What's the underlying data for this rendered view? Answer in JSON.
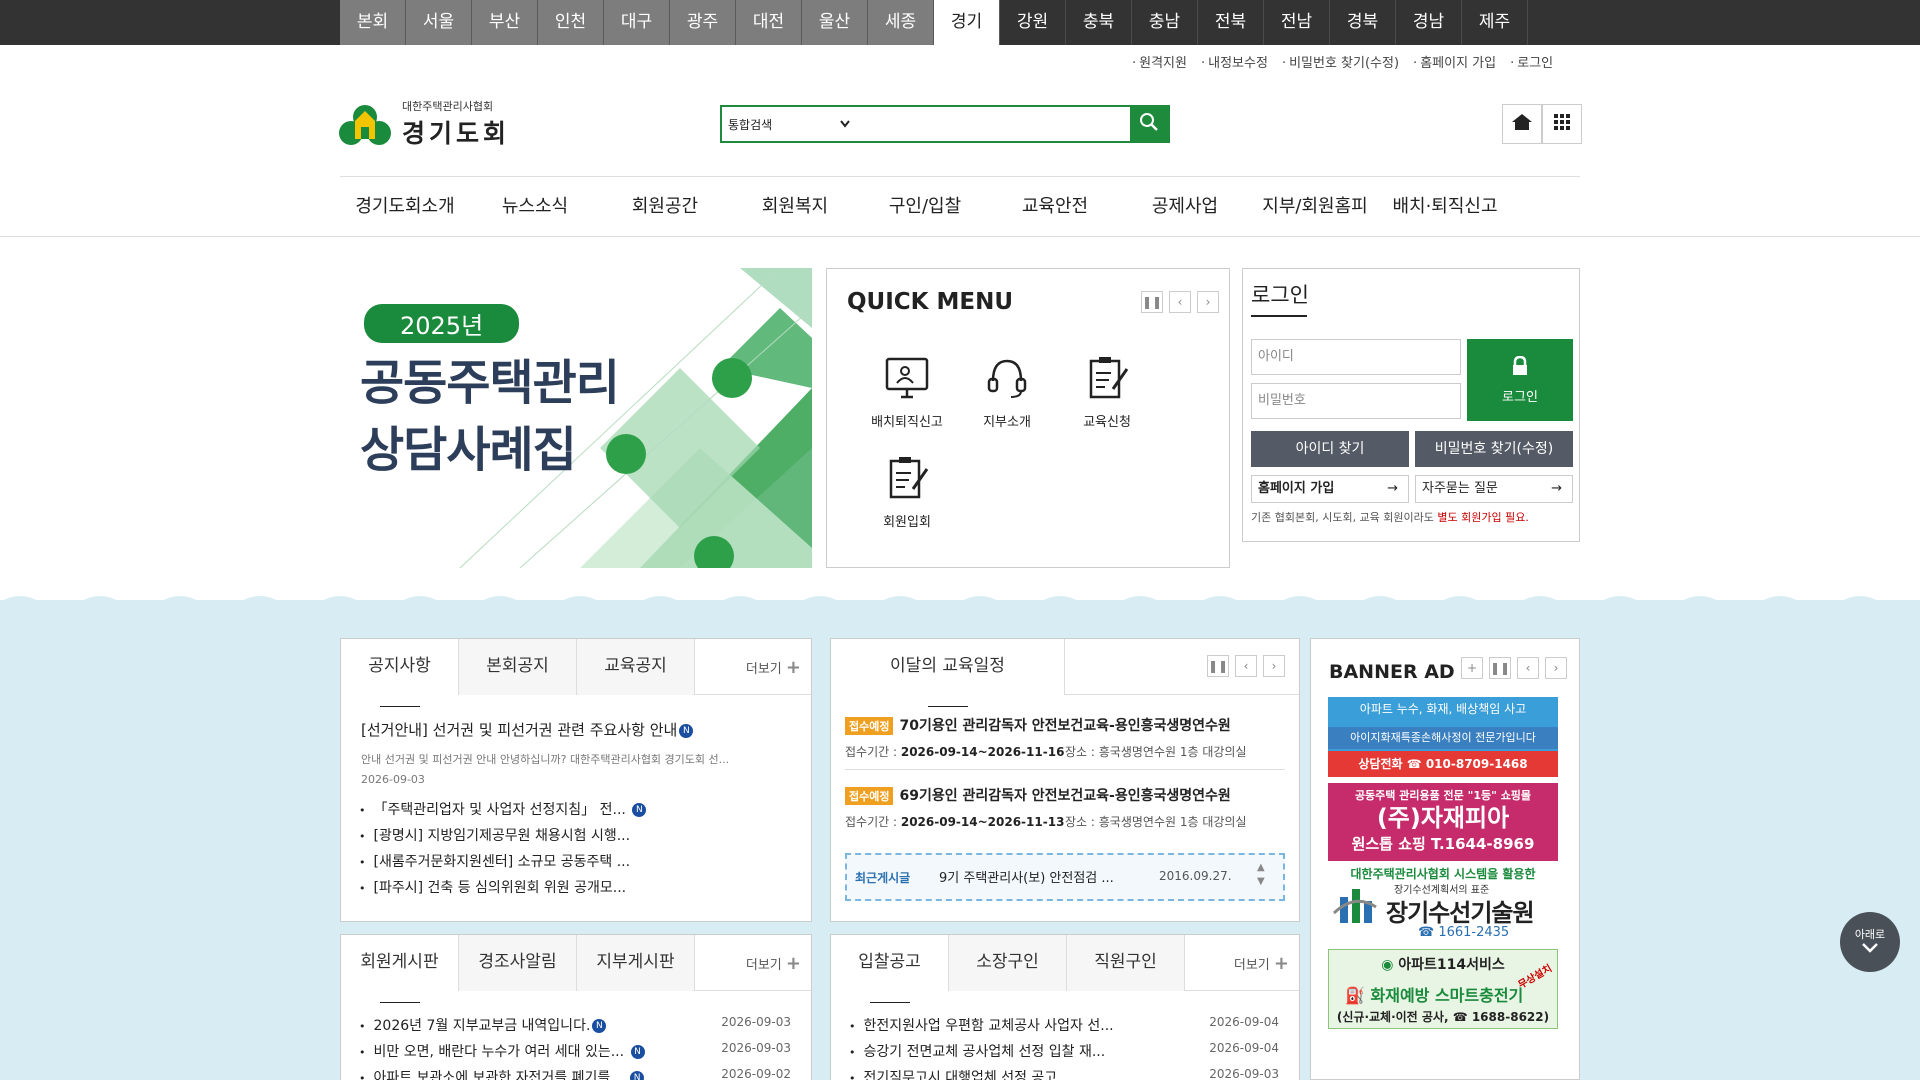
{
  "regions": {
    "tabs": [
      "본회",
      "서울",
      "부산",
      "인천",
      "대구",
      "광주",
      "대전",
      "울산",
      "세종",
      "경기",
      "강원",
      "충북",
      "충남",
      "전북",
      "전남",
      "경북",
      "경남",
      "제주"
    ],
    "active": "경기"
  },
  "util_links": [
    "원격지원",
    "내정보수정",
    "비밀번호 찾기(수정)",
    "홈페이지 가입",
    "로그인"
  ],
  "logo": {
    "small": "대한주택관리사협회",
    "big": "경기도회"
  },
  "search": {
    "select": "통합검색",
    "placeholder": ""
  },
  "gnb": [
    "경기도회소개",
    "뉴스소식",
    "회원공간",
    "회원복지",
    "구인/입찰",
    "교육안전",
    "공제사업",
    "지부/회원홈피",
    "배치·퇴직신고"
  ],
  "visual": {
    "year": "2025년",
    "title_line1": "공동주택관리",
    "title_line2": "상담사례집"
  },
  "quick_menu": {
    "title": "QUICK MENU",
    "items": [
      {
        "label": "배치퇴직신고",
        "icon": "monitor-icon"
      },
      {
        "label": "지부소개",
        "icon": "headset-icon"
      },
      {
        "label": "교육신청",
        "icon": "clipboard-pen-icon"
      },
      {
        "label": "회원입회",
        "icon": "clipboard-pen-icon"
      }
    ]
  },
  "login": {
    "title": "로그인",
    "id_placeholder": "아이디",
    "pw_placeholder": "비밀번호",
    "button": "로그인",
    "find_id": "아이디 찾기",
    "find_pw": "비밀번호 찾기(수정)",
    "join": "홈페이지 가입",
    "faq": "자주묻는 질문",
    "note_prefix": "기존 협회본회, 시도회, 교육 회원이라도 ",
    "note_highlight": "별도 회원가입 필요."
  },
  "notice_box": {
    "tabs": [
      "공지사항",
      "본회공지",
      "교육공지"
    ],
    "more": "더보기",
    "featured_title": "[선거안내] 선거권 및 피선거권 관련 주요사항 안내",
    "featured_summary": "안내 선거권 및 피선거권 안내 안녕하십니까? 대한주택관리사협회 경기도회 선...",
    "featured_date": "2026-09-03",
    "items": [
      "「주택관리업자 및 사업자 선정지침」 전...",
      "[광명시] 지방임기제공무원 채용시험 시행...",
      "[새롬주거문화지원센터] 소규모 공동주택 ...",
      "[파주시] 건축 등 심의위원회 위원 공개모..."
    ]
  },
  "edu_box": {
    "title": "이달의 교육일정",
    "items": [
      {
        "badge": "접수예정",
        "title": "70기용인 관리감독자 안전보건교육-용인흥국생명연수원",
        "period_label": "접수기간 : ",
        "period": "2026-09-14~2026-11-16",
        "place": "장소 : 흥국생명연수원 1층 대강의실"
      },
      {
        "badge": "접수예정",
        "title": "69기용인 관리감독자 안전보건교육-용인흥국생명연수원",
        "period_label": "접수기간 : ",
        "period": "2026-09-14~2026-11-13",
        "place": "장소 : 흥국생명연수원 1층 대강의실"
      }
    ],
    "recent_label": "최근게시글",
    "recent_text": "9기 주택관리사(보) 안전점검 ...",
    "recent_date": "2016.09.27."
  },
  "banner_ad": {
    "title": "BANNER AD",
    "b1_top": "아파트 누수, 화재, 배상책임 사고",
    "b1_mid": "아이지화재특종손해사정이 전문가입니다",
    "b1_bottom": "상담전화 ☎ 010-8709-1468",
    "b2_top": "공동주택 관리용품 전문 \"1등\" 쇼핑몰",
    "b2_mid": "(주)자재피아",
    "b2_bottom": "원스톱 쇼핑 T.1644-8969",
    "b3_top": "대한주택관리사협회 시스템을 활용한",
    "b3_sub": "장기수선계획서의 표준",
    "b3_main": "장기수선기술원",
    "b3_phone": "☎ 1661-2435",
    "b4_top": "아파트114서비스",
    "b4_main": "화재예방 스마트충전기",
    "b4_badge": "무상설치",
    "b4_bottom": "(신규·교체·이전 공사, ☎ 1688-8622)"
  },
  "member_box": {
    "tabs": [
      "회원게시판",
      "경조사알림",
      "지부게시판"
    ],
    "more": "더보기",
    "items": [
      {
        "text": "2026년 7월 지부교부금 내역입니다.",
        "date": "2026-09-03"
      },
      {
        "text": "비만 오면, 배란다 누수가 여러 세대 있는...",
        "date": "2026-09-03"
      },
      {
        "text": "아파트 보관소에 보관한 자전거를 폐기를...",
        "date": "2026-09-02"
      }
    ]
  },
  "bid_box": {
    "tabs": [
      "입찰공고",
      "소장구인",
      "직원구인"
    ],
    "more": "더보기",
    "items": [
      {
        "text": "한전지원사업 우편함 교체공사 사업자 선...",
        "date": "2026-09-04"
      },
      {
        "text": "승강기 전면교체 공사업체 선정 입찰 재...",
        "date": "2026-09-04"
      },
      {
        "text": "전기직무고시 대행업체 선정 공고",
        "date": "2026-09-03"
      }
    ]
  },
  "scroll_down": {
    "label": "아래로"
  }
}
